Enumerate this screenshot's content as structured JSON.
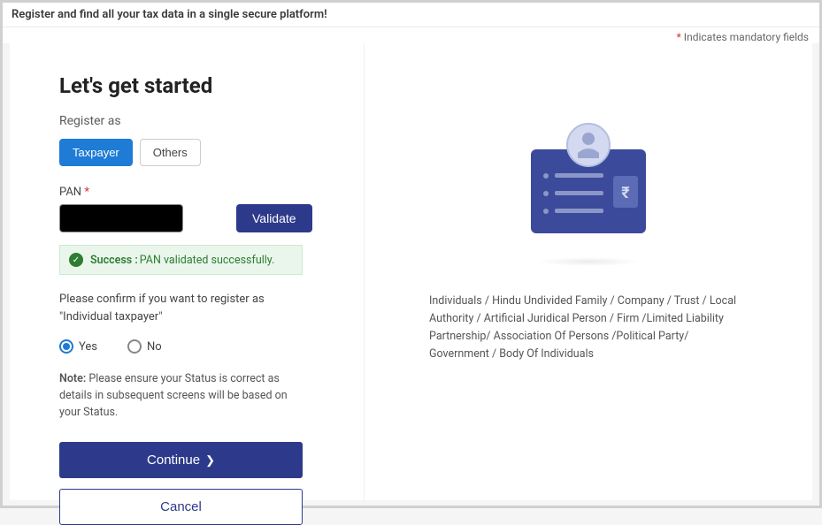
{
  "banner": "Register and find all your tax data in a single secure platform!",
  "mandatory": {
    "star": "*",
    "text": " Indicates mandatory fields"
  },
  "title": "Let's get started",
  "registerAs": {
    "label": "Register as",
    "option_taxpayer": "Taxpayer",
    "option_others": "Others"
  },
  "pan": {
    "label": "PAN ",
    "star": "*",
    "value": "",
    "validate_label": "Validate"
  },
  "success": {
    "label": "Success : ",
    "message": "PAN validated successfully."
  },
  "confirm": {
    "prefix": "Please confirm if you want to register as \"",
    "type": "Individual taxpayer",
    "suffix": "\""
  },
  "radio": {
    "yes": "Yes",
    "no": "No"
  },
  "note": {
    "bold": "Note: ",
    "text": "Please ensure your Status is correct as details in subsequent screens will be based on your Status."
  },
  "buttons": {
    "continue": "Continue",
    "cancel": "Cancel"
  },
  "rightInfo": "Individuals / Hindu Undivided Family / Company / Trust / Local Authority / Artificial Juridical Person / Firm /Limited Liability Partnership/ Association Of Persons /Political Party/ Government / Body Of Individuals"
}
